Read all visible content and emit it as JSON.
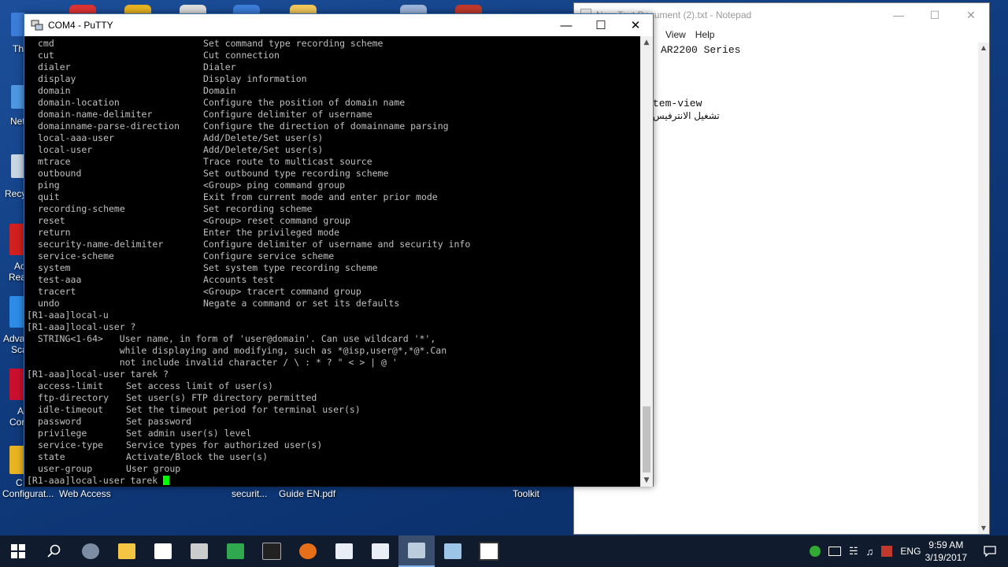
{
  "desktop": {
    "left_labels": [
      "Th",
      "Net",
      "Recy",
      "Ac",
      "Rea",
      "Adva",
      "Sca",
      "A",
      "Cor",
      "C"
    ],
    "bottom_labels": [
      "Configurat...",
      "Web Access",
      "securit...",
      "Guide EN.pdf",
      "Toolkit"
    ]
  },
  "notepad": {
    "title": "New Text Document (2).txt - Notepad",
    "menu": [
      "View",
      "Help"
    ],
    "lines": [
      "AR2200 Series",
      "tem-view",
      "تشغيل الانترفيس"
    ]
  },
  "putty": {
    "title": "COM4 - PuTTY",
    "command_list": [
      {
        "cmd": "cmd",
        "desc": "Set command type recording scheme"
      },
      {
        "cmd": "cut",
        "desc": "Cut connection"
      },
      {
        "cmd": "dialer",
        "desc": "Dialer"
      },
      {
        "cmd": "display",
        "desc": "Display information"
      },
      {
        "cmd": "domain",
        "desc": "Domain"
      },
      {
        "cmd": "domain-location",
        "desc": "Configure the position of domain name"
      },
      {
        "cmd": "domain-name-delimiter",
        "desc": "Configure delimiter of username"
      },
      {
        "cmd": "domainname-parse-direction",
        "desc": "Configure the direction of domainname parsing"
      },
      {
        "cmd": "local-aaa-user",
        "desc": "Add/Delete/Set user(s)"
      },
      {
        "cmd": "local-user",
        "desc": "Add/Delete/Set user(s)"
      },
      {
        "cmd": "mtrace",
        "desc": "Trace route to multicast source"
      },
      {
        "cmd": "outbound",
        "desc": "Set outbound type recording scheme"
      },
      {
        "cmd": "ping",
        "desc": "<Group> ping command group"
      },
      {
        "cmd": "quit",
        "desc": "Exit from current mode and enter prior mode"
      },
      {
        "cmd": "recording-scheme",
        "desc": "Set recording scheme"
      },
      {
        "cmd": "reset",
        "desc": "<Group> reset command group"
      },
      {
        "cmd": "return",
        "desc": "Enter the privileged mode"
      },
      {
        "cmd": "security-name-delimiter",
        "desc": "Configure delimiter of username and security info"
      },
      {
        "cmd": "service-scheme",
        "desc": "Configure service scheme"
      },
      {
        "cmd": "system",
        "desc": "Set system type recording scheme"
      },
      {
        "cmd": "test-aaa",
        "desc": "Accounts test"
      },
      {
        "cmd": "tracert",
        "desc": "<Group> tracert command group"
      },
      {
        "cmd": "undo",
        "desc": "Negate a command or set its defaults"
      }
    ],
    "lines_mid": [
      "[R1-aaa]local-u",
      "[R1-aaa]local-user ?",
      "  STRING<1-64>   User name, in form of 'user@domain'. Can use wildcard '*',",
      "                 while displaying and modifying, such as *@isp,user@*,*@*.Can",
      "                 not include invalid character / \\ : * ? \" < > | @ '",
      "[R1-aaa]local-user tarek ?"
    ],
    "user_options": [
      {
        "cmd": "access-limit",
        "desc": "Set access limit of user(s)"
      },
      {
        "cmd": "ftp-directory",
        "desc": "Set user(s) FTP directory permitted"
      },
      {
        "cmd": "idle-timeout",
        "desc": "Set the timeout period for terminal user(s)"
      },
      {
        "cmd": "password",
        "desc": "Set password"
      },
      {
        "cmd": "privilege",
        "desc": "Set admin user(s) level"
      },
      {
        "cmd": "service-type",
        "desc": "Service types for authorized user(s)"
      },
      {
        "cmd": "state",
        "desc": "Activate/Block the user(s)"
      },
      {
        "cmd": "user-group",
        "desc": "User group"
      }
    ],
    "prompt": "[R1-aaa]local-user tarek "
  },
  "taskbar": {
    "language": "ENG",
    "time": "9:59 AM",
    "date": "3/19/2017"
  },
  "colors": {
    "terminal_bg": "#000000",
    "terminal_fg": "#c0c0c0",
    "cursor": "#00ff00",
    "taskbar": "#101c2e",
    "desktop": "#0f3a7c"
  }
}
